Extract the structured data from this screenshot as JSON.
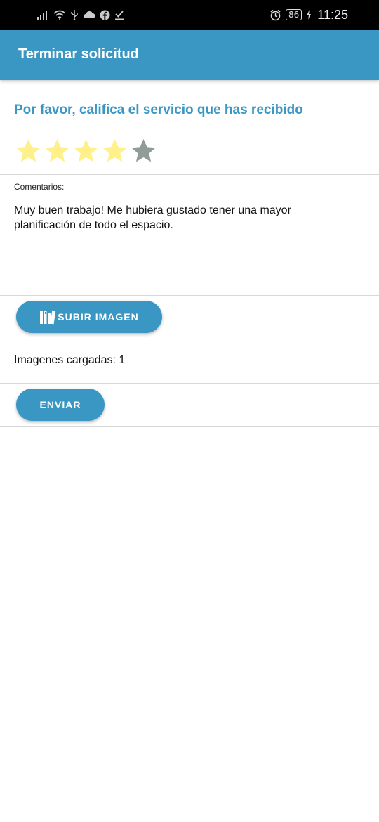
{
  "status_bar": {
    "battery": "86",
    "time": "11:25",
    "icons": [
      "signal-icon",
      "wifi-icon",
      "usb-icon",
      "cloud-icon",
      "facebook-icon",
      "download-done-icon",
      "alarm-icon",
      "battery-icon",
      "charging-icon"
    ]
  },
  "app_bar": {
    "title": "Terminar solicitud",
    "color": "#3a97c3"
  },
  "rating": {
    "prompt": "Por favor, califica el servicio que has recibido",
    "value": 4,
    "max": 5,
    "filled_color": "#fff08a",
    "empty_color": "#8f9c9a"
  },
  "comments": {
    "label": "Comentarios:",
    "value": "Muy buen trabajo! Me hubiera gustado tener una mayor planificación de todo el espacio."
  },
  "upload": {
    "button_label": "SUBIR IMAGEN",
    "icon": "image-library-icon",
    "uploaded_text": "Imagenes cargadas: 1"
  },
  "submit": {
    "button_label": "ENVIAR"
  }
}
